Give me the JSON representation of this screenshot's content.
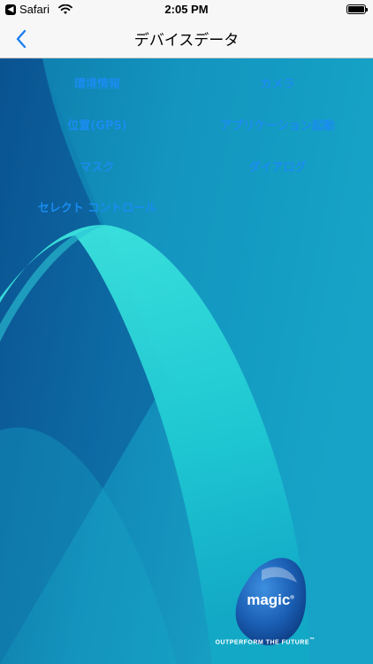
{
  "status_bar": {
    "back_app": "Safari",
    "time": "2:05 PM",
    "battery_level": 1.0
  },
  "nav": {
    "title": "デバイスデータ",
    "back_icon": "chevron-left-icon"
  },
  "menu": {
    "items": [
      {
        "label": "環境情報"
      },
      {
        "label": "カメラ"
      },
      {
        "label": "位置(GPS)"
      },
      {
        "label": "アプリケーション起動"
      },
      {
        "label": "マスク"
      },
      {
        "label": "ダイアログ"
      },
      {
        "label": "セレクト コントロール"
      }
    ]
  },
  "logo": {
    "name": "magic",
    "trademark": "®",
    "tagline": "OUTPERFORM THE FUTURE",
    "tagline_tm": "™"
  },
  "colors": {
    "link": "#1a8cf0",
    "bg_dark": "#0b5c99",
    "bg_teal": "#1fb8c8",
    "bg_light": "#3ee0dc"
  }
}
